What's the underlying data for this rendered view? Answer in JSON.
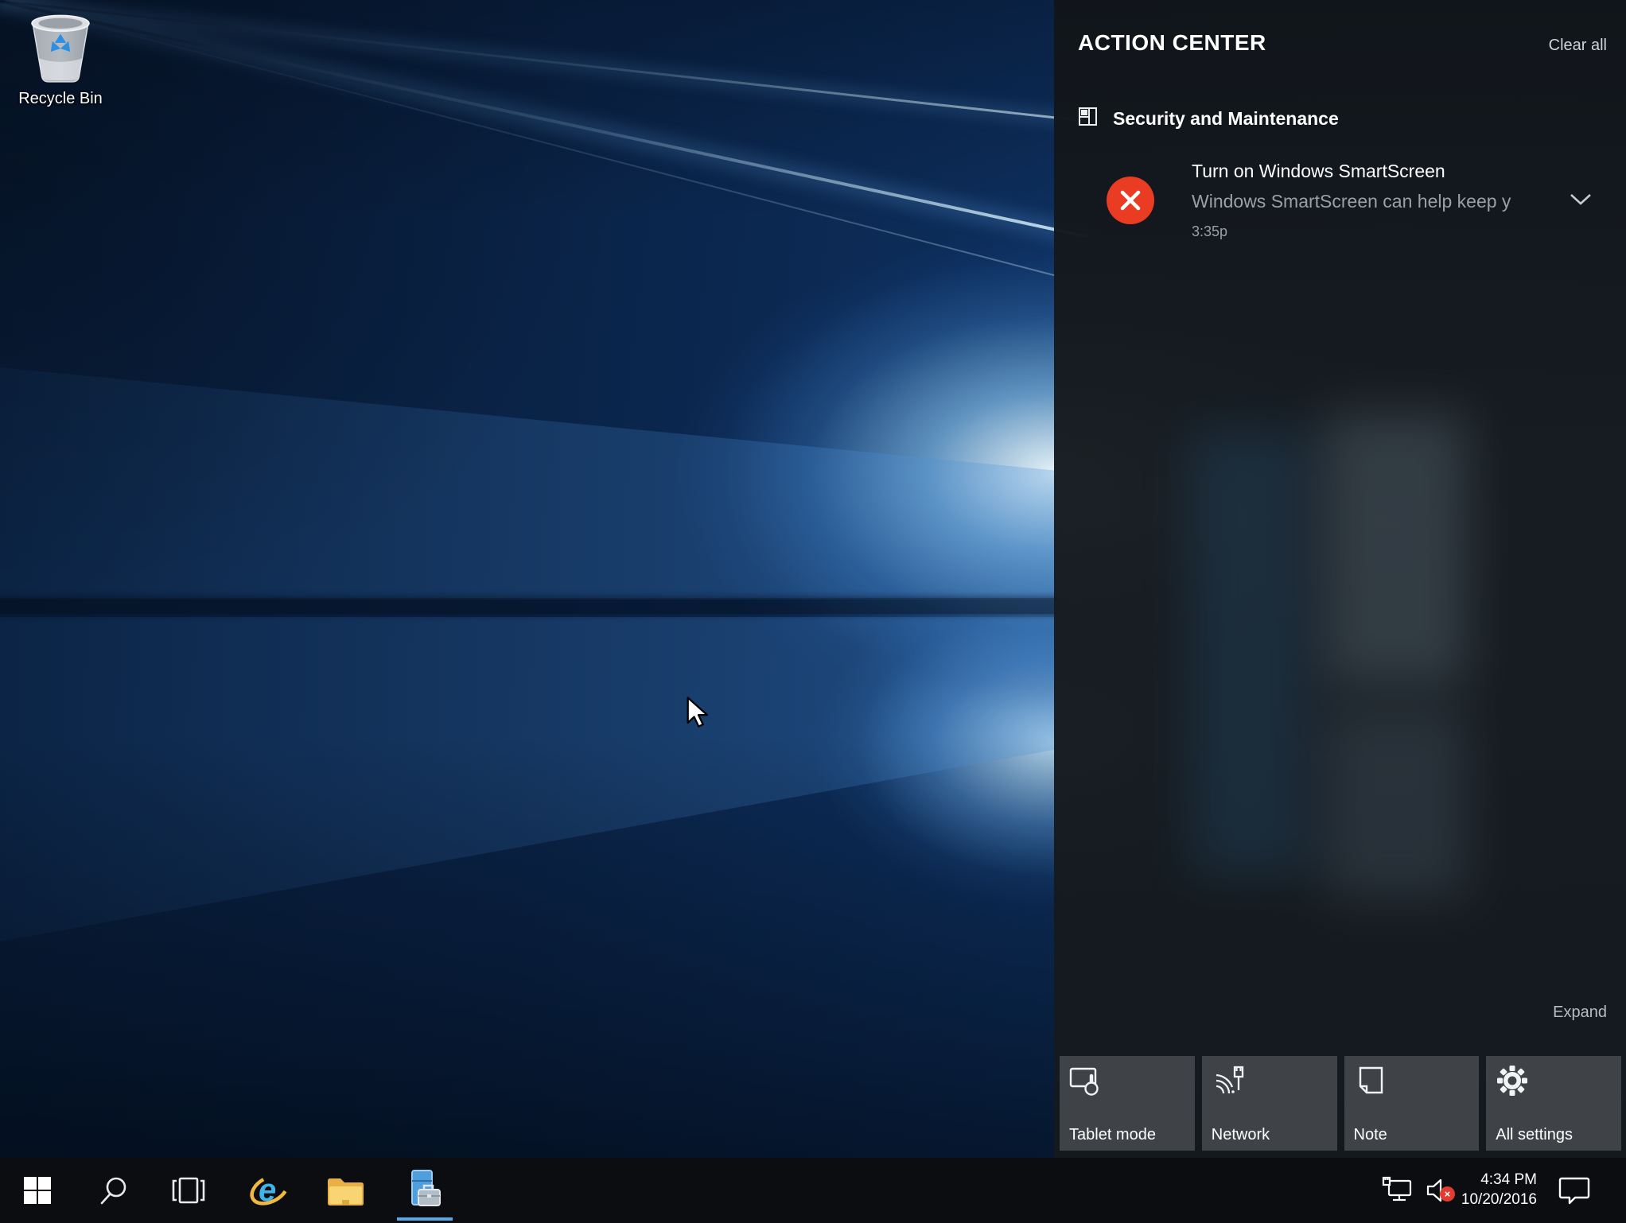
{
  "desktop": {
    "recycle_bin": {
      "label": "Recycle Bin",
      "icon": "recycle-bin-icon"
    },
    "cursor": "arrow"
  },
  "action_center": {
    "title": "ACTION CENTER",
    "clear_all": "Clear all",
    "expand": "Expand",
    "section": {
      "icon": "security-maintenance-icon",
      "title": "Security and Maintenance"
    },
    "notification": {
      "severity_icon": "error-x-icon",
      "title": "Turn on Windows SmartScreen",
      "body": "Windows SmartScreen can help keep y",
      "time": "3:35p",
      "expander_icon": "chevron-down-icon"
    },
    "quick_actions": [
      {
        "label": "Tablet mode",
        "icon": "tablet-mode-icon"
      },
      {
        "label": "Network",
        "icon": "network-signal-icon"
      },
      {
        "label": "Note",
        "icon": "note-icon"
      },
      {
        "label": "All settings",
        "icon": "settings-gear-icon"
      }
    ]
  },
  "taskbar": {
    "buttons": [
      {
        "name": "start",
        "icon": "windows-start-icon"
      },
      {
        "name": "search",
        "icon": "search-icon"
      },
      {
        "name": "task-view",
        "icon": "task-view-icon"
      },
      {
        "name": "internet-explorer",
        "icon": "internet-explorer-icon"
      },
      {
        "name": "file-explorer",
        "icon": "file-explorer-icon"
      },
      {
        "name": "toolbox-app",
        "icon": "toolbox-app-icon",
        "active": true
      }
    ],
    "tray": {
      "network_icon": "ethernet-network-icon",
      "volume_icon": "volume-muted-icon",
      "time": "4:34 PM",
      "date": "10/20/2016",
      "action_center_icon": "action-center-bubble-icon"
    }
  },
  "colors": {
    "error_red": "#ea3b23",
    "accent_blue": "#57a8e8",
    "tile_bg": "#3f4347",
    "panel_bg": "#1c2126",
    "taskbar_bg": "#0b0d10"
  }
}
